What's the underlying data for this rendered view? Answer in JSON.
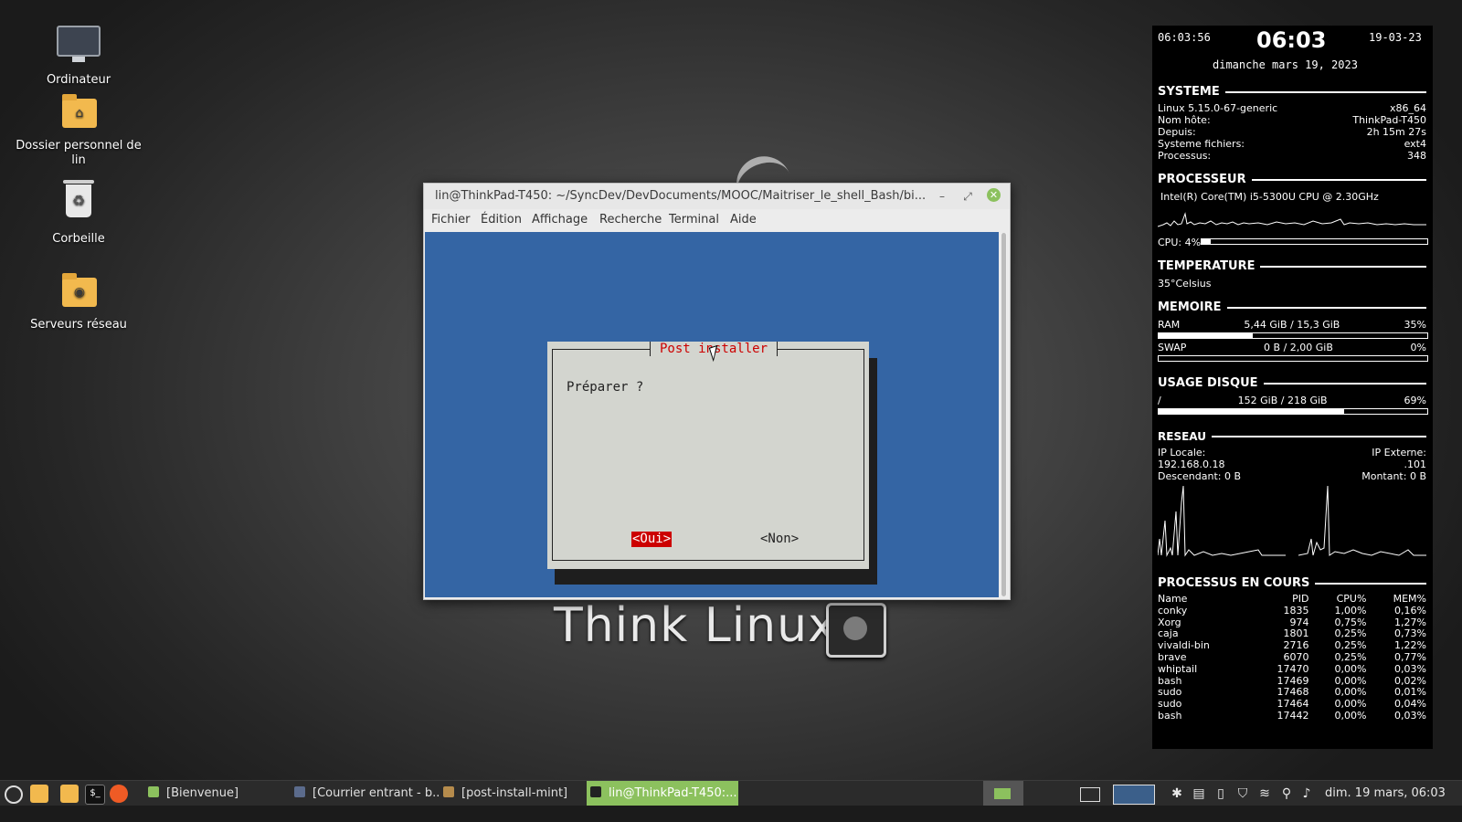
{
  "desktop": {
    "icons": [
      {
        "label": "Ordinateur"
      },
      {
        "label": "Dossier personnel de lin"
      },
      {
        "label": "Corbeille"
      },
      {
        "label": "Serveurs réseau"
      }
    ],
    "wallpaper_text": "Think Linux"
  },
  "terminal": {
    "title": "lin@ThinkPad-T450: ~/SyncDev/DevDocuments/MOOC/Maitriser_le_shell_Bash/bi...",
    "menus": [
      "Fichier",
      "Édition",
      "Affichage",
      "Recherche",
      "Terminal",
      "Aide"
    ],
    "dialog": {
      "title": "Post installer",
      "text": "Préparer ?",
      "yes": "<Oui>",
      "no": "<Non>"
    }
  },
  "conky": {
    "time_seconds": "06:03:56",
    "time": "06:03",
    "date_short": "19-03-23",
    "date_long": "dimanche mars 19, 2023",
    "systeme": {
      "heading": "SYSTEME",
      "kernel": "Linux 5.15.0-67-generic",
      "arch": "x86_64",
      "host_label": "Nom hôte:",
      "host": "ThinkPad-T450",
      "uptime_label": "Depuis:",
      "uptime": "2h 15m 27s",
      "fs_label": "Systeme fichiers:",
      "fs": "ext4",
      "proc_label": "Processus:",
      "proc": "348"
    },
    "processeur": {
      "heading": "PROCESSEUR",
      "model": "Intel(R) Core(TM) i5-5300U CPU @ 2.30GHz",
      "cpu_label": "CPU: 4%",
      "cpu_percent": 4
    },
    "temperature": {
      "heading": "TEMPERATURE",
      "value": "35°Celsius"
    },
    "memoire": {
      "heading": "MEMOIRE",
      "ram_label": "RAM",
      "ram_value": "5,44 GiB / 15,3 GiB",
      "ram_pct": "35%",
      "ram_fraction": 0.35,
      "swap_label": "SWAP",
      "swap_value": "0 B / 2,00 GiB",
      "swap_pct": "0%",
      "swap_fraction": 0
    },
    "disque": {
      "heading": "USAGE DISQUE",
      "mount": "/",
      "value": "152 GiB / 218 GiB",
      "pct": "69%",
      "fraction": 0.69
    },
    "reseau": {
      "heading": "RESEAU",
      "ip_local_label": "IP Locale:",
      "ip_local": "192.168.0.18",
      "ip_ext_label": "IP Externe:",
      "ip_ext": ".101",
      "down": "Descendant: 0 B",
      "up": "Montant: 0 B"
    },
    "processus": {
      "heading": "PROCESSUS EN COURS",
      "headers": [
        "Name",
        "PID",
        "CPU%",
        "MEM%"
      ],
      "rows": [
        [
          "conky",
          "1835",
          "1,00%",
          "0,16%"
        ],
        [
          "Xorg",
          "974",
          "0,75%",
          "1,27%"
        ],
        [
          "caja",
          "1801",
          "0,25%",
          "0,73%"
        ],
        [
          "vivaldi-bin",
          "2716",
          "0,25%",
          "1,22%"
        ],
        [
          "brave",
          "6070",
          "0,25%",
          "0,77%"
        ],
        [
          "whiptail",
          "17470",
          "0,00%",
          "0,03%"
        ],
        [
          "bash",
          "17469",
          "0,00%",
          "0,02%"
        ],
        [
          "sudo",
          "17468",
          "0,00%",
          "0,01%"
        ],
        [
          "sudo",
          "17464",
          "0,00%",
          "0,04%"
        ],
        [
          "bash",
          "17442",
          "0,00%",
          "0,03%"
        ]
      ]
    }
  },
  "taskbar": {
    "tasks": [
      {
        "label": "[Bienvenue]"
      },
      {
        "label": "[Courrier entrant - b..."
      },
      {
        "label": "[post-install-mint]"
      },
      {
        "label": "lin@ThinkPad-T450:..."
      }
    ],
    "clock": "dim. 19 mars, 06:03",
    "colors": {
      "accent": "#8cc15e",
      "terminal_bg": "#3465a4",
      "dialog_title": "#cc0000"
    }
  }
}
